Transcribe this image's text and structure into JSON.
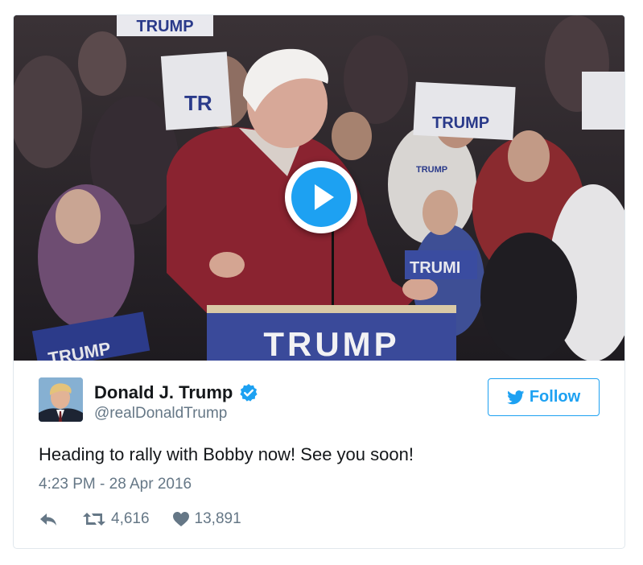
{
  "media": {
    "signs": {
      "podium": "TRUMP",
      "left": "TRUMP",
      "right": "TRUMI",
      "top": "TRUMP",
      "back_left": "TR",
      "back_right": "TRUMP",
      "shirt": "TRUMP"
    }
  },
  "user": {
    "name": "Donald J. Trump",
    "handle": "@realDonaldTrump"
  },
  "follow": {
    "label": "Follow"
  },
  "tweet": {
    "text": "Heading to rally with Bobby now! See you soon!",
    "timestamp": "4:23 PM - 28 Apr 2016"
  },
  "stats": {
    "retweets": "4,616",
    "likes": "13,891"
  },
  "colors": {
    "accent": "#1da1f2",
    "text": "#14171a",
    "muted": "#657786",
    "border": "#e1e8ed"
  }
}
